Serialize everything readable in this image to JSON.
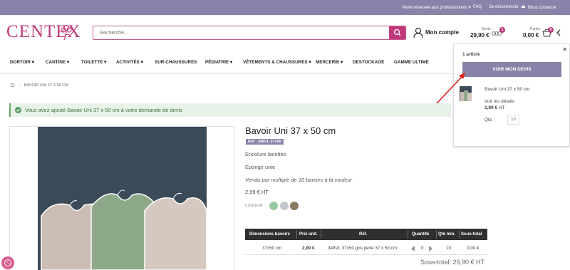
{
  "topbar": {
    "pro_link": "Vente réservée aux professionnels",
    "faq": "FAQ",
    "logout": "Se déconnecter",
    "contact": "Nous contacter"
  },
  "logo": {
    "text": "Centex"
  },
  "search": {
    "placeholder": "Recherche..."
  },
  "account": {
    "label": "Mon compte"
  },
  "devis": {
    "label": "Devis",
    "amount": "29,90 €",
    "badge": "1"
  },
  "cart": {
    "label": "Panier",
    "amount": "0,00 €",
    "badge": "0"
  },
  "nav": {
    "items": [
      "DORTOIR",
      "CANTINE",
      "TOILETTE",
      "ACTIVITÉS",
      "SUR-CHAUSSURES",
      "PÉDIATRIE",
      "VÊTEMENTS & CHAUSSURES",
      "MERCERIE",
      "DESTOCKAGE",
      "GAMME ULTIME"
    ]
  },
  "breadcrumb": {
    "current": "BAVOIR UNI 37 X 50 CM"
  },
  "alert": {
    "message": "Vous avez ajouté Bavoir Uni 37 x 50 cm à votre demande de devis"
  },
  "product": {
    "title": "Bavoir Uni 37 x 50 cm",
    "ref": "Réf : 348VL 37x50",
    "line1": "Encolure lacettes",
    "line2": "Eponge unie",
    "line3": "Vendu par multiple de 10 bavoirs à la couleur",
    "price": "2,99 € HT",
    "couleur_label": "COULEUR :",
    "swatches": [
      "#98c8a0",
      "#c4c8ce",
      "#8c7a66"
    ]
  },
  "table": {
    "headers": [
      "Dimensions bavoirs",
      "Prix unit.",
      "Réf.",
      "Quantité",
      "Qté min.",
      "Sous-total"
    ],
    "row": {
      "dim": "37x50 cm",
      "price": "2,99 €",
      "ref": "348VL 37x50 gris perle 37 x 50 cm",
      "qty": "0",
      "min": "10",
      "subtotal": "0,00 €"
    },
    "total": "Sous-total: 29,90 € HT"
  },
  "panel": {
    "count": "1 article",
    "button": "VOIR MON DEVIS",
    "item_name": "Bavoir Uni 37 x 50 cm",
    "details": "Voir les détails",
    "item_price": "2,99 €",
    "item_price_suffix": "HT",
    "qty_label": "Qté :",
    "qty_value": "10"
  },
  "colors": {
    "topbar": "#8883a8",
    "brand": "#c0397b",
    "alert_bg": "#e8f2e9",
    "alert_text": "#3d6e41"
  }
}
